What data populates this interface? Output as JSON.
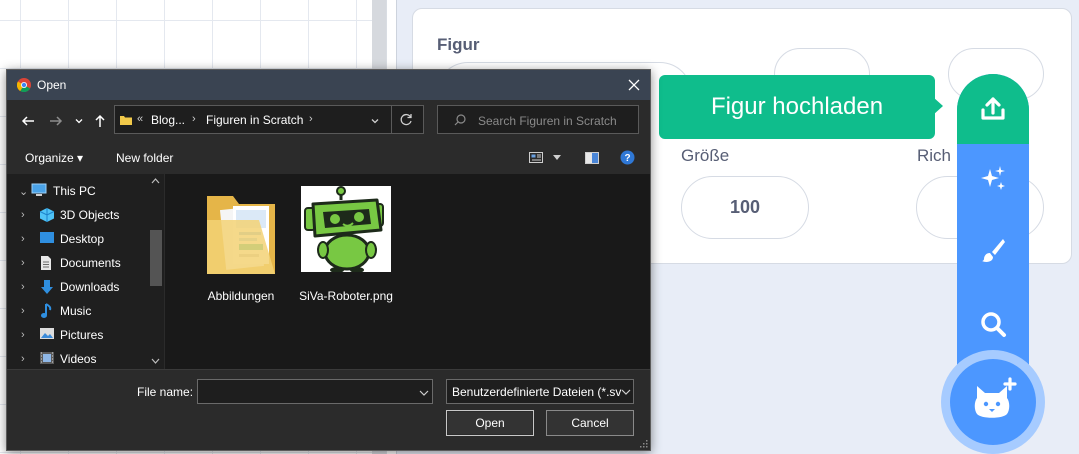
{
  "scratch": {
    "sprite_panel_title": "Figur",
    "size_label": "Größe",
    "direction_label": "Rich",
    "size_value": "100",
    "upload_tooltip": "Figur hochladen"
  },
  "sprite_menu": {
    "items": [
      "upload-icon",
      "surprise-icon",
      "paint-icon",
      "search-icon",
      "choose-sprite-icon"
    ],
    "colors": {
      "blue": "#4c97ff",
      "green": "#0fbd8c"
    }
  },
  "dialog": {
    "title": "Open",
    "address": {
      "breadcrumbs": [
        "Blog...",
        "Figuren in Scratch"
      ]
    },
    "search_placeholder": "Search Figuren in Scratch",
    "toolbar": {
      "organize": "Organize",
      "new_folder": "New folder"
    },
    "tree": [
      {
        "label": "This PC",
        "icon": "pc-icon",
        "expanded": true
      },
      {
        "label": "3D Objects",
        "icon": "3d-objects-icon"
      },
      {
        "label": "Desktop",
        "icon": "desktop-icon"
      },
      {
        "label": "Documents",
        "icon": "documents-icon"
      },
      {
        "label": "Downloads",
        "icon": "downloads-icon"
      },
      {
        "label": "Music",
        "icon": "music-icon"
      },
      {
        "label": "Pictures",
        "icon": "pictures-icon"
      },
      {
        "label": "Videos",
        "icon": "videos-icon"
      }
    ],
    "files": [
      {
        "name": "Abbildungen",
        "type": "folder"
      },
      {
        "name": "SiVa-Roboter.png",
        "type": "image"
      }
    ],
    "file_name_label": "File name:",
    "file_name_value": "",
    "filter": "Benutzerdefinierte Dateien (*.sv",
    "open_button": "Open",
    "cancel_button": "Cancel"
  }
}
